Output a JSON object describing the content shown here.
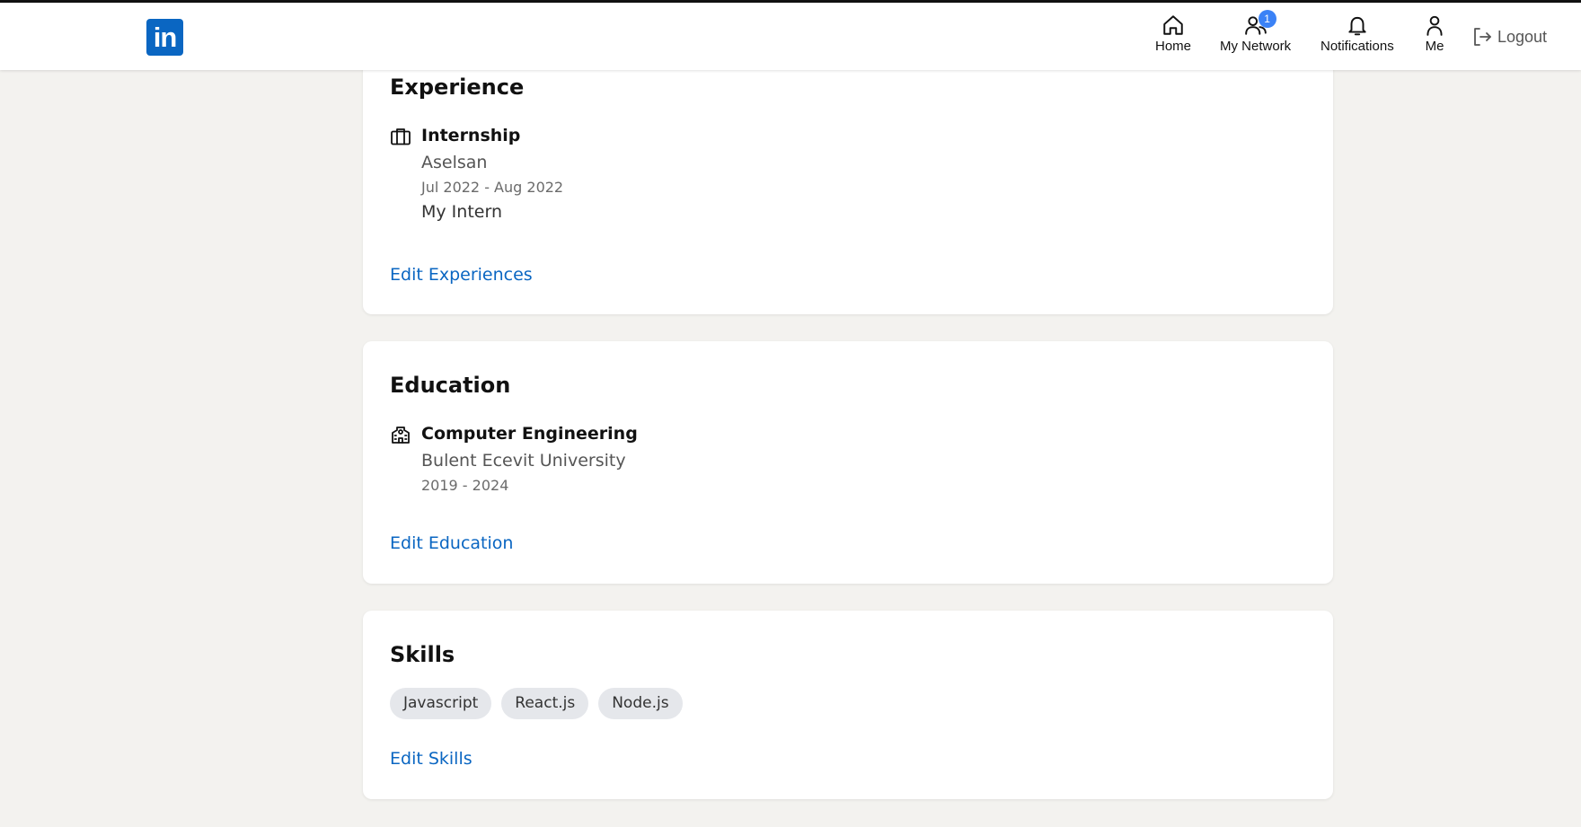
{
  "nav": {
    "items": [
      {
        "label": "Home",
        "icon": "home-icon"
      },
      {
        "label": "My Network",
        "icon": "network-icon",
        "badge": "1"
      },
      {
        "label": "Notifications",
        "icon": "bell-icon"
      },
      {
        "label": "Me",
        "icon": "user-icon"
      }
    ],
    "logout_label": "Logout",
    "logo_text": "in"
  },
  "experience": {
    "title": "Experience",
    "entry": {
      "title": "Internship",
      "company": "Aselsan",
      "dates": "Jul 2022 - Aug 2022",
      "description": "My Intern"
    },
    "edit_label": "Edit Experiences"
  },
  "education": {
    "title": "Education",
    "entry": {
      "title": "Computer Engineering",
      "school": "Bulent Ecevit University",
      "dates": "2019 - 2024"
    },
    "edit_label": "Edit Education"
  },
  "skills": {
    "title": "Skills",
    "items": [
      "Javascript",
      "React.js",
      "Node.js"
    ],
    "edit_label": "Edit Skills"
  },
  "colors": {
    "brand": "#0a66c2",
    "badge": "#3b82f6",
    "background": "#f3f2ef"
  }
}
